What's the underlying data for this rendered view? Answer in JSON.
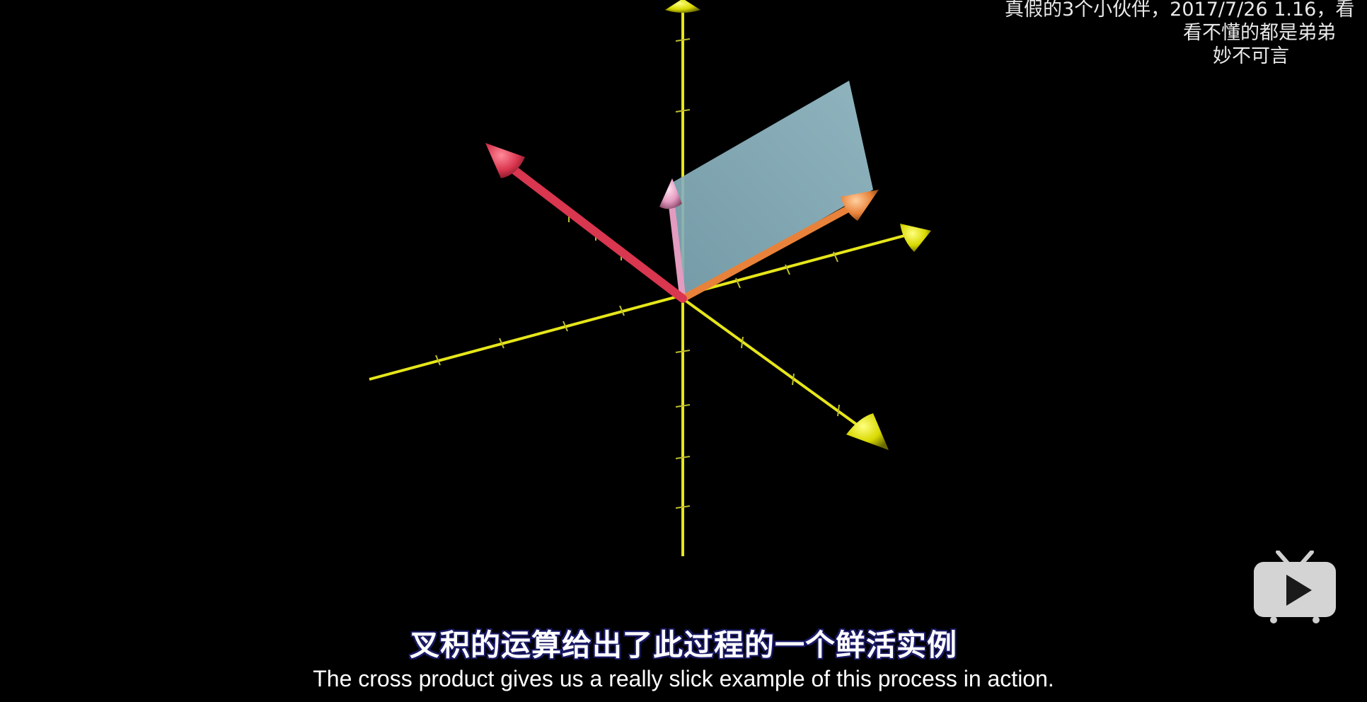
{
  "danmaku": [
    "真假的3个小伙伴，2017/7/26 1.16，看",
    "看不懂的都是弟弟",
    "妙不可言"
  ],
  "subtitle": {
    "chinese": "叉积的运算给出了此过程的一个鲜活实例",
    "english": "The cross product gives us a really slick example of this process in action."
  },
  "icons": {
    "watermark": "bilibili-tv-logo-icon"
  },
  "colors": {
    "background": "#000000",
    "axis": "#e6e61a",
    "vector_red": "#d9364f",
    "vector_orange": "#e8823a",
    "vector_pink": "#e39bbf",
    "plane": "#8fb8c4",
    "subtitle_outline": "#1a1a66"
  }
}
